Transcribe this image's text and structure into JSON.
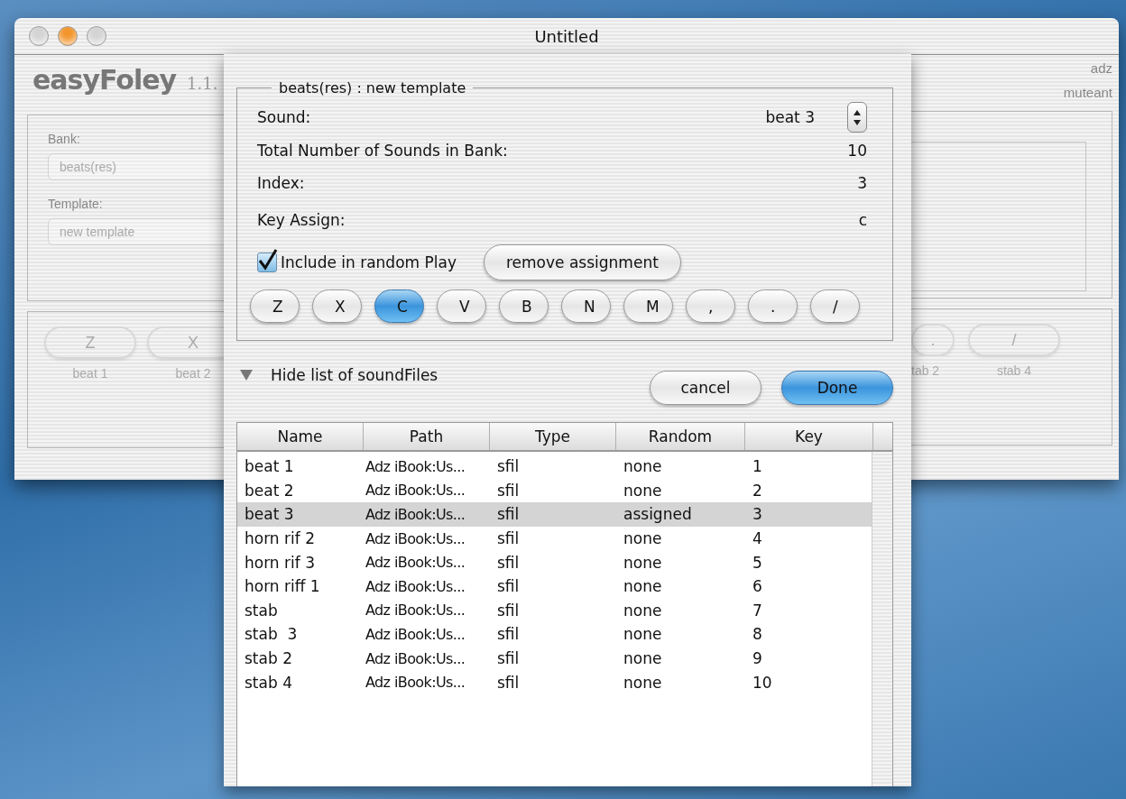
{
  "window": {
    "title": "Untitled",
    "controls": [
      {
        "color": "#d4d4d4"
      },
      {
        "color": "#f2952c"
      },
      {
        "color": "#d4d4d4"
      }
    ]
  },
  "main": {
    "logo": "easyFoley",
    "version": "1.1.",
    "bank_label": "Bank:",
    "bank_value": "beats(res)",
    "template_label": "Template:",
    "template_value": "new template",
    "user": "adz",
    "group": "muteant",
    "keys_left": [
      {
        "key": "Z",
        "label": "beat 1"
      },
      {
        "key": "X",
        "label": "beat 2"
      }
    ],
    "keys_right": [
      {
        "key": ".",
        "label": "tab 2",
        "clipped": true
      },
      {
        "key": "/",
        "label": "stab 4",
        "clipped": false
      }
    ]
  },
  "sheet": {
    "legend": "beats(res) : new template",
    "fields": [
      {
        "kind": "stepper",
        "label": "Sound:",
        "value": "beat 3"
      },
      {
        "kind": "text",
        "label": "Total Number of Sounds in Bank:",
        "value": "10"
      },
      {
        "kind": "text",
        "label": "Index:",
        "value": "3"
      },
      {
        "kind": "text",
        "label": "Key Assign:",
        "value": "c"
      }
    ],
    "include": {
      "label": "Include in random Play",
      "checked": true
    },
    "remove_button": "remove assignment",
    "keys": [
      {
        "label": "Z",
        "selected": false
      },
      {
        "label": "X",
        "selected": false
      },
      {
        "label": "C",
        "selected": true
      },
      {
        "label": "V",
        "selected": false
      },
      {
        "label": "B",
        "selected": false
      },
      {
        "label": "N",
        "selected": false
      },
      {
        "label": "M",
        "selected": false
      },
      {
        "label": ",",
        "selected": false
      },
      {
        "label": ".",
        "selected": false
      },
      {
        "label": "/",
        "selected": false
      }
    ],
    "disclosure": {
      "label": "Hide list of soundFiles",
      "expanded": true
    },
    "buttons": [
      {
        "label": "cancel",
        "default": false
      },
      {
        "label": "Done",
        "default": true
      }
    ],
    "table": {
      "columns": [
        "Name",
        "Path",
        "Type",
        "Random",
        "Key"
      ],
      "rows": [
        {
          "cells": [
            "beat 1",
            "Adz iBook:Us...",
            "sfil",
            "none",
            "1"
          ],
          "selected": false
        },
        {
          "cells": [
            "beat 2",
            "Adz iBook:Us...",
            "sfil",
            "none",
            "2"
          ],
          "selected": false
        },
        {
          "cells": [
            "beat 3",
            "Adz iBook:Us...",
            "sfil",
            "assigned",
            "3"
          ],
          "selected": true
        },
        {
          "cells": [
            "horn rif 2",
            "Adz iBook:Us...",
            "sfil",
            "none",
            "4"
          ],
          "selected": false
        },
        {
          "cells": [
            "horn rif 3",
            "Adz iBook:Us...",
            "sfil",
            "none",
            "5"
          ],
          "selected": false
        },
        {
          "cells": [
            "horn riff 1",
            "Adz iBook:Us...",
            "sfil",
            "none",
            "6"
          ],
          "selected": false
        },
        {
          "cells": [
            "stab",
            "Adz iBook:Us...",
            "sfil",
            "none",
            "7"
          ],
          "selected": false
        },
        {
          "cells": [
            "stab  3",
            "Adz iBook:Us...",
            "sfil",
            "none",
            "8"
          ],
          "selected": false
        },
        {
          "cells": [
            "stab 2",
            "Adz iBook:Us...",
            "sfil",
            "none",
            "9"
          ],
          "selected": false
        },
        {
          "cells": [
            "stab 4",
            "Adz iBook:Us...",
            "sfil",
            "none",
            "10"
          ],
          "selected": false
        }
      ]
    }
  }
}
